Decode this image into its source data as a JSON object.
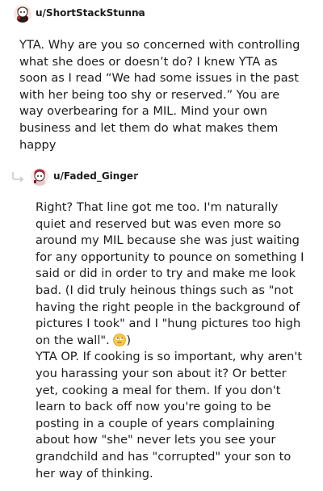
{
  "comments": [
    {
      "username": "u/ShortStackStunna",
      "separator": "•",
      "paragraphs": [
        "YTA. Why are you so concerned with controlling what she does or doesn’t do? I knew YTA as soon as I read “We had some issues in the past with her being too shy or reserved.” You are way overbearing for a MIL. Mind your own business and let them do what makes them happy"
      ]
    },
    {
      "username": "u/Faded_Ginger",
      "separator": "•",
      "paragraph1_text": "Right? That line got me too. I'm naturally quiet and reserved but was even more so around my MIL because she was just waiting for any opportunity to pounce on something I said or did in order to try and make me look bad. (I did truly heinous things such as \"not having the right people in the background of pictures I took\" and I \"hung pictures too high on the wall\". ",
      "paragraph1_tail": ")",
      "paragraph2": "YTA OP. If cooking is so important, why aren't you harassing your son about it? Or better yet, cooking a meal for them. If you don't learn to back off now you're going to be posting in a couple of years complaining about how \"she\" never lets you see your grandchild and has \"corrupted\" your son to her way of thinking."
    }
  ],
  "icons": {
    "avatar1": "snoo-avatar-icon",
    "avatar2": "snoo-avatar-icon",
    "reply": "reply-thread-arrow-icon",
    "emoji": "rolling-eyes-emoji-icon"
  }
}
